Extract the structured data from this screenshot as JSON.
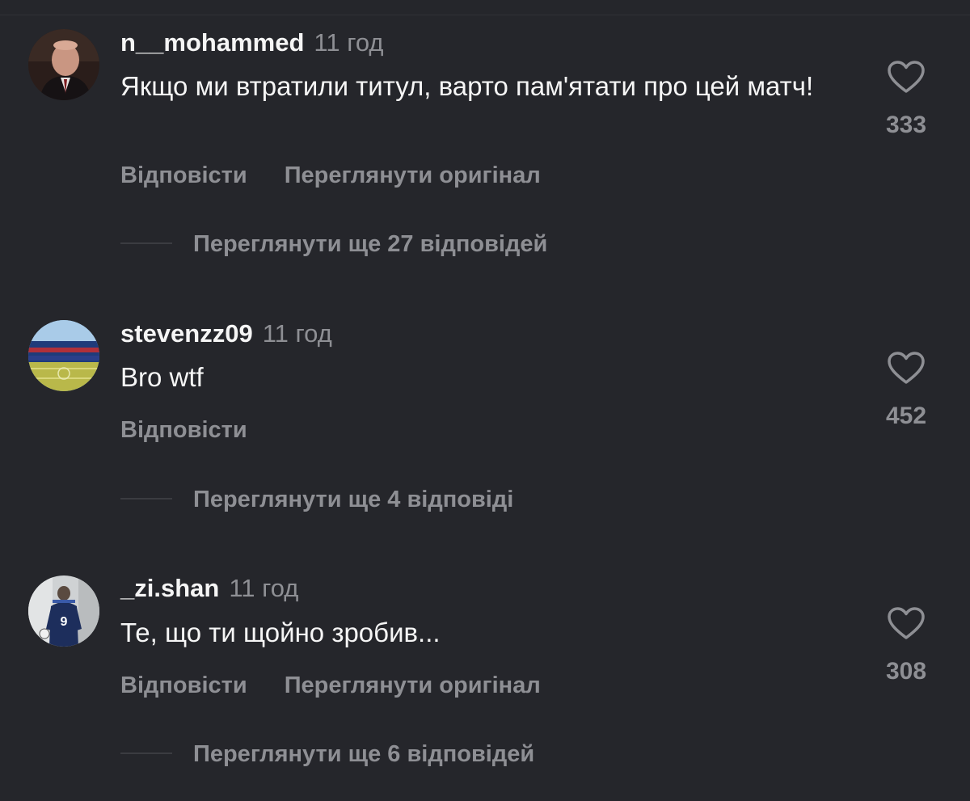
{
  "comments": [
    {
      "username": "n__mohammed",
      "time": "11 год",
      "text": "Якщо ми втратили титул, варто пам'ятати про цей матч!",
      "reply_label": "Відповісти",
      "view_original_label": "Переглянути оригінал",
      "likes": "333",
      "view_replies_label": "Переглянути ще 27 відповідей"
    },
    {
      "username": "stevenzz09",
      "time": "11 год",
      "text": "Bro wtf",
      "reply_label": "Відповісти",
      "likes": "452",
      "view_replies_label": "Переглянути ще 4 відповіді"
    },
    {
      "username": "_zi.shan",
      "time": "11 год",
      "text": "Те, що ти щойно зробив...",
      "reply_label": "Відповісти",
      "view_original_label": "Переглянути оригінал",
      "likes": "308",
      "view_replies_label": "Переглянути ще 6 відповідей",
      "avatar_jersey_number": "9"
    }
  ],
  "colors": {
    "background": "#25262b",
    "primary_text": "#f5f5f5",
    "secondary_text": "#8e8f94"
  },
  "icons": {
    "like": "heart-outline-icon"
  }
}
